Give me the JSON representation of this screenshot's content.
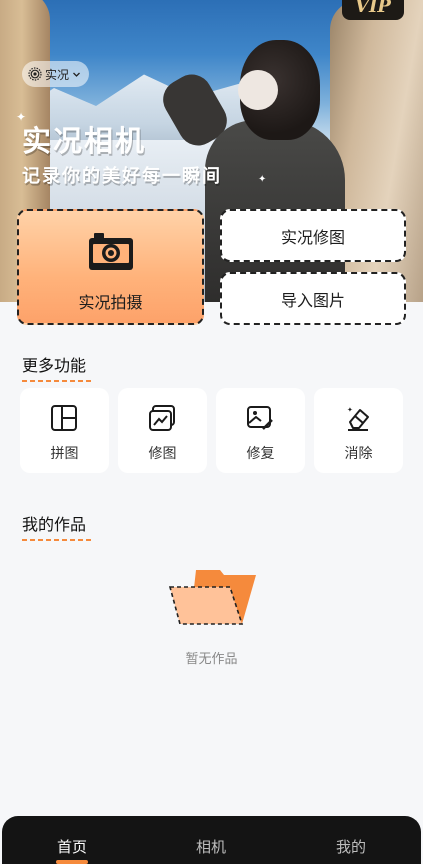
{
  "hero": {
    "badge": "VIP",
    "mode_chip": {
      "label": "实况",
      "icon": "live-photo-icon",
      "caret": "chevron-down-icon"
    },
    "title": "实况相机",
    "subtitle": "记录你的美好每一瞬间"
  },
  "actions": {
    "primary": {
      "label": "实况拍摄",
      "icon": "camera-icon"
    },
    "edit": {
      "label": "实况修图"
    },
    "import": {
      "label": "导入图片"
    }
  },
  "more_features": {
    "title": "更多功能",
    "items": [
      {
        "label": "拼图",
        "icon": "collage-icon"
      },
      {
        "label": "修图",
        "icon": "photo-edit-icon"
      },
      {
        "label": "修复",
        "icon": "photo-repair-icon"
      },
      {
        "label": "消除",
        "icon": "eraser-icon"
      }
    ]
  },
  "my_works": {
    "title": "我的作品",
    "empty_text": "暂无作品",
    "empty_icon": "empty-folder-icon"
  },
  "tabbar": {
    "tabs": [
      {
        "label": "首页",
        "active": true
      },
      {
        "label": "相机",
        "active": false
      },
      {
        "label": "我的",
        "active": false
      }
    ]
  },
  "colors": {
    "accent": "#f58a3c",
    "primary_card_top": "#ffd2a8",
    "primary_card_bottom": "#fda26a",
    "tabbar_bg": "#141414",
    "page_bg": "#f6f7f9"
  }
}
